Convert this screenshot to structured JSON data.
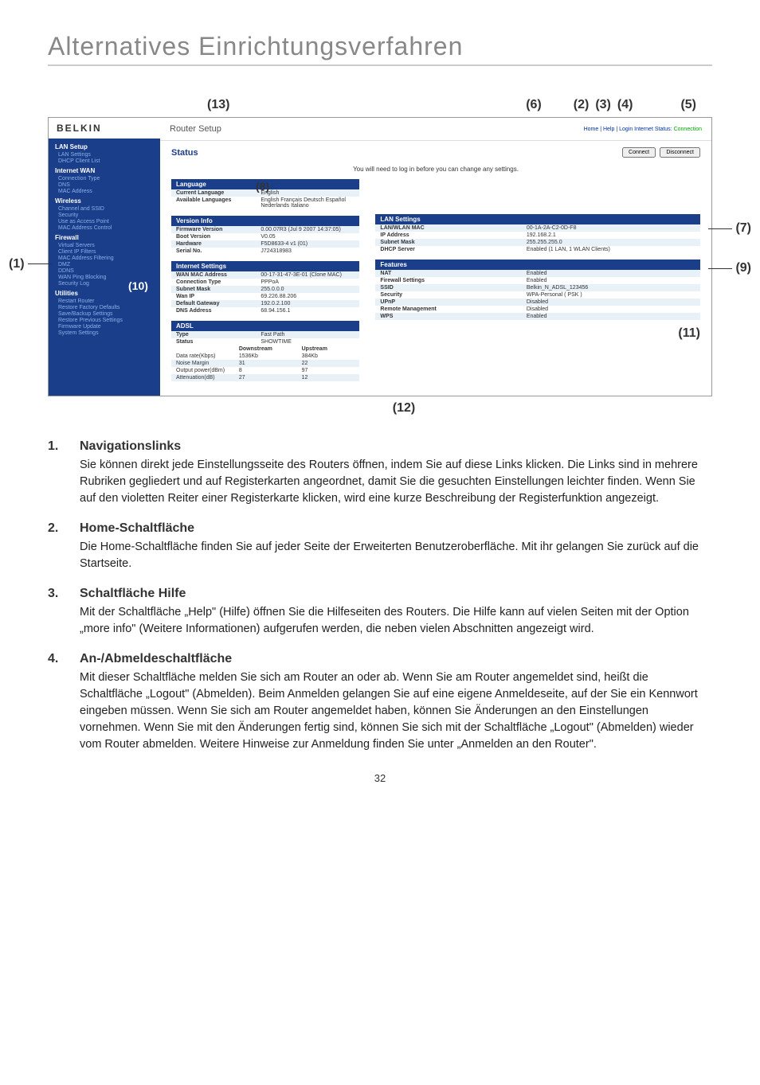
{
  "page": {
    "title": "Alternatives Einrichtungsverfahren",
    "number": "32"
  },
  "callouts": {
    "c1": "(1)",
    "c2": "(2)",
    "c3": "(3)",
    "c4": "(4)",
    "c5": "(5)",
    "c6": "(6)",
    "c7": "(7)",
    "c8": "(8)",
    "c9": "(9)",
    "c10": "(10)",
    "c11": "(11)",
    "c12": "(12)",
    "c13": "(13)"
  },
  "router": {
    "brand": "BELKIN",
    "setup": "Router Setup",
    "headerLinks": "Home | Help | Login   Internet Status:",
    "connStatus": "Connection",
    "status": "Status",
    "connect": "Connect",
    "disconnect": "Disconnect",
    "loginNote": "You will need to log in before you can change any settings.",
    "sidebar": {
      "lanSetup": "LAN Setup",
      "lanSettings": "LAN Settings",
      "dhcpClientList": "DHCP Client List",
      "internetWan": "Internet WAN",
      "connectionType": "Connection Type",
      "dns": "DNS",
      "macAddress": "MAC Address",
      "wireless": "Wireless",
      "channelSsid": "Channel and SSID",
      "security": "Security",
      "useAsAP": "Use as Access Point",
      "macAddrCtrl": "MAC Address Control",
      "firewall": "Firewall",
      "virtualServers": "Virtual Servers",
      "clientIpFilters": "Client IP Filters",
      "macAddrFilter": "MAC Address Filtering",
      "dmz": "DMZ",
      "ddns": "DDNS",
      "wanPing": "WAN Ping Blocking",
      "securityLog": "Security Log",
      "utilities": "Utilities",
      "restartRouter": "Restart Router",
      "restoreFactory": "Restore Factory Defaults",
      "saveBackup": "Save/Backup Settings",
      "restorePrev": "Restore Previous Settings",
      "firmwareUpdate": "Firmware Update",
      "systemSettings": "System Settings"
    },
    "panels": {
      "language": {
        "title": "Language",
        "currentK": "Current Language",
        "currentV": "English",
        "availK": "Available Languages",
        "availV": "English Français Deutsch Español Nederlands Italiano"
      },
      "version": {
        "title": "Version Info",
        "fwK": "Firmware Version",
        "fwV": "0.00.07R3 (Jul 9 2007 14:37:05)",
        "bootK": "Boot Version",
        "bootV": "V0.05",
        "hwK": "Hardware",
        "hwV": "F5D8633-4 v1 (01)",
        "snK": "Serial No.",
        "snV": "J724318983"
      },
      "internet": {
        "title": "Internet Settings",
        "macK": "WAN MAC Address",
        "macV": "00-17-31-47-3E-01 (Clone MAC)",
        "ctK": "Connection Type",
        "ctV": "PPPoA",
        "smK": "Subnet Mask",
        "smV": "255.0.0.0",
        "wipK": "Wan IP",
        "wipV": "69.226.88.206",
        "dgK": "Default Gateway",
        "dgV": "192.0.2.100",
        "dnsK": "DNS Address",
        "dnsV": "68.94.156.1"
      },
      "lan": {
        "title": "LAN Settings",
        "macK": "LAN/WLAN MAC",
        "macV": "00-1A-2A-C2-0D-F8",
        "ipK": "IP Address",
        "ipV": "192.168.2.1",
        "smK": "Subnet Mask",
        "smV": "255.255.255.0",
        "dhcpK": "DHCP Server",
        "dhcpV": "Enabled (1 LAN, 1 WLAN Clients)"
      },
      "features": {
        "title": "Features",
        "natK": "NAT",
        "natV": "Enabled",
        "fwK": "Firewall Settings",
        "fwV": "Enabled",
        "ssidK": "SSID",
        "ssidV": "Belkin_N_ADSL_123456",
        "secK": "Security",
        "secV": "WPA-Personal ( PSK )",
        "upnpK": "UPnP",
        "upnpV": "Disabled",
        "rmK": "Remote Management",
        "rmV": "Disabled",
        "wpsK": "WPS",
        "wpsV": "Enabled"
      },
      "adsl": {
        "title": "ADSL",
        "typeK": "Type",
        "typeV": "Fast Path",
        "statusK": "Status",
        "statusV": "SHOWTIME",
        "colEmpty": "",
        "colDown": "Downstream",
        "colUp": "Upstream",
        "rateK": "Data rate(Kbps)",
        "rateD": "1536Kb",
        "rateU": "384Kb",
        "noiseK": "Noise Margin",
        "noiseD": "31",
        "noiseU": "22",
        "powK": "Output power(dBm)",
        "powD": "8",
        "powU": "97",
        "attK": "Attenuation(dB)",
        "attD": "27",
        "attU": "12"
      }
    }
  },
  "sections": {
    "s1": {
      "num": "1.",
      "title": "Navigationslinks",
      "text": "Sie können direkt jede Einstellungsseite des Routers öffnen, indem Sie auf diese Links klicken. Die Links sind in mehrere Rubriken gegliedert und auf Registerkarten angeordnet, damit Sie die gesuchten Einstellungen leichter finden. Wenn Sie auf den violetten Reiter einer Registerkarte klicken, wird eine kurze Beschreibung der Registerfunktion angezeigt."
    },
    "s2": {
      "num": "2.",
      "title": "Home-Schaltfläche",
      "text": "Die Home-Schaltfläche finden Sie auf jeder Seite der Erweiterten Benutzeroberfläche. Mit ihr gelangen Sie zurück auf die Startseite."
    },
    "s3": {
      "num": "3.",
      "title": "Schaltfläche Hilfe",
      "text": "Mit der Schaltfläche „Help\" (Hilfe) öffnen Sie die Hilfeseiten des Routers. Die Hilfe kann auf vielen Seiten mit der Option „more info\" (Weitere Informationen) aufgerufen werden, die neben vielen Abschnitten angezeigt wird."
    },
    "s4": {
      "num": "4.",
      "title": "An-/Abmeldeschaltfläche",
      "text": "Mit dieser Schaltfläche melden Sie sich am Router an oder ab. Wenn Sie am Router angemeldet sind, heißt die Schaltfläche „Logout\" (Abmelden). Beim Anmelden gelangen Sie auf eine eigene Anmeldeseite, auf der Sie ein Kennwort eingeben müssen. Wenn Sie sich am Router angemeldet haben, können Sie Änderungen an den Einstellungen vornehmen. Wenn Sie mit den Änderungen fertig sind, können Sie sich mit der Schaltfläche „Logout\" (Abmelden) wieder vom Router abmelden. Weitere Hinweise zur Anmeldung finden Sie unter „Anmelden an den Router\"."
    }
  }
}
